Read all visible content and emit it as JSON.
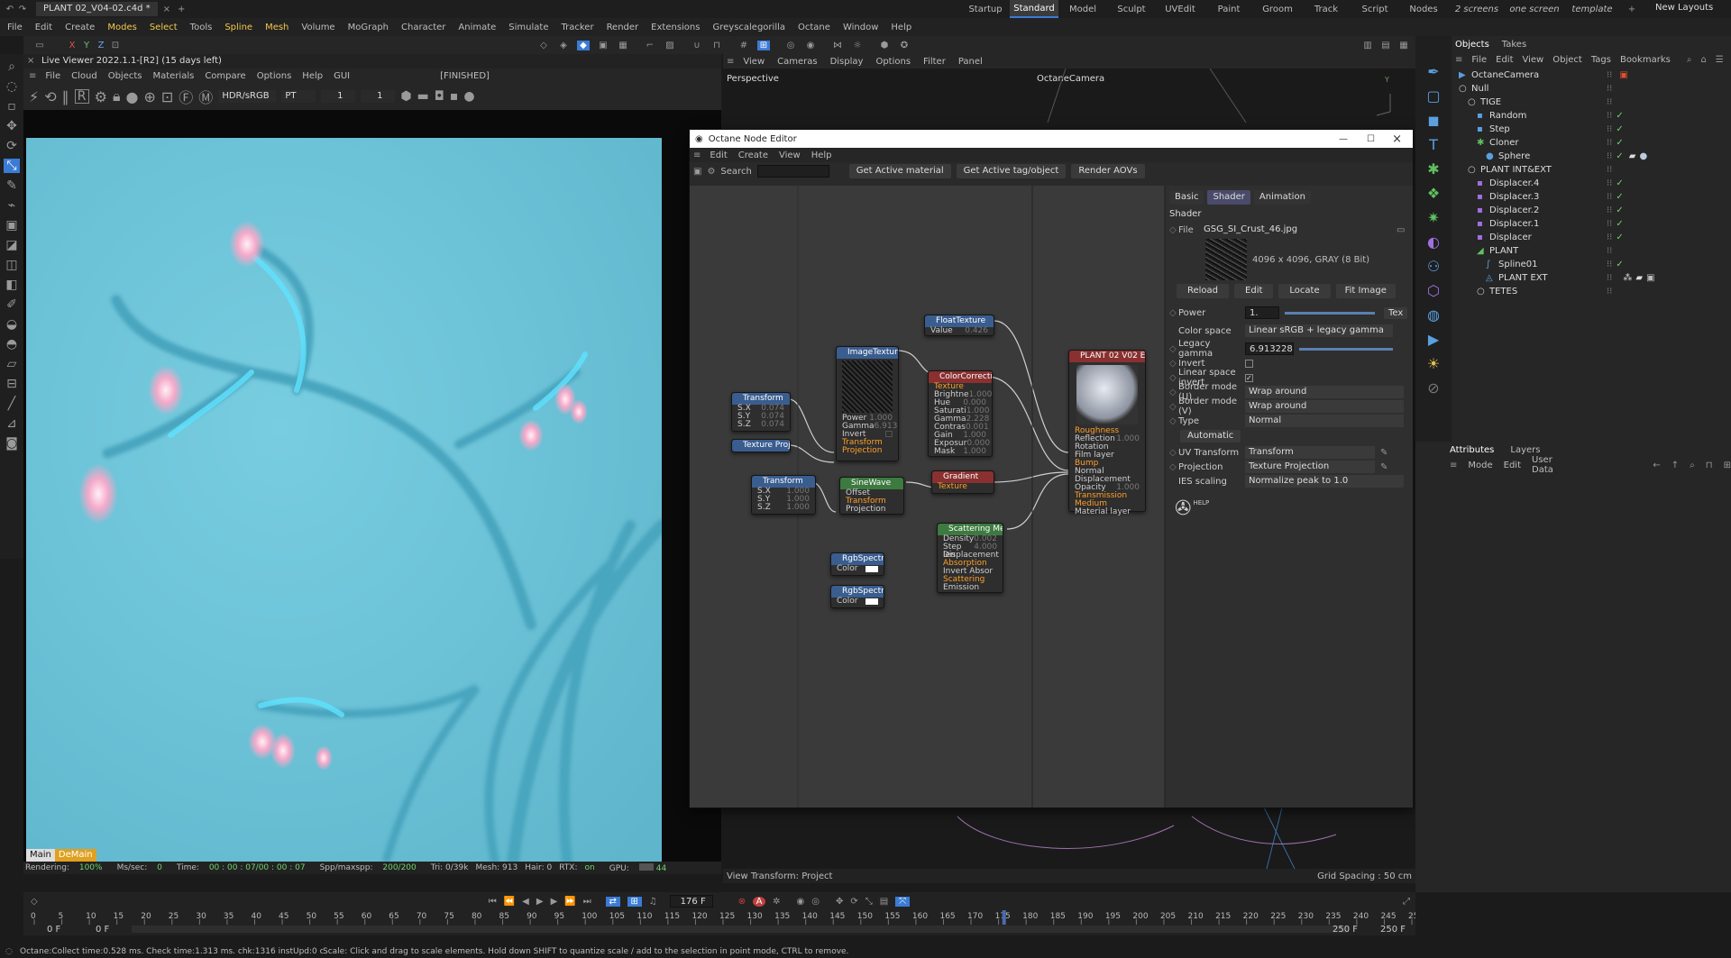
{
  "title_bar": {
    "file_tab": "PLANT 02_V04-02.c4d *",
    "layouts": [
      "Startup",
      "Standard",
      "Model",
      "Sculpt",
      "UVEdit",
      "Paint",
      "Groom",
      "Track",
      "Script",
      "Nodes",
      "2 screens",
      "one screen",
      "template"
    ],
    "active_layout": "Standard",
    "new_layouts": "New Layouts"
  },
  "main_menu": [
    "File",
    "Edit",
    "Create",
    "Modes",
    "Select",
    "Tools",
    "Spline",
    "Mesh",
    "Volume",
    "MoGraph",
    "Character",
    "Animate",
    "Simulate",
    "Tracker",
    "Render",
    "Extensions",
    "Greyscalegorilla",
    "Octane",
    "Window",
    "Help"
  ],
  "live_viewer": {
    "title": "Live Viewer 2022.1.1-[R2] (15 days left)",
    "menu": [
      "File",
      "Cloud",
      "Objects",
      "Materials",
      "Compare",
      "Options",
      "Help",
      "GUI"
    ],
    "status": "[FINISHED]",
    "colorspace": "HDR/sRGB",
    "kernel": "PT",
    "field1": "1",
    "field2": "1",
    "tabs": [
      "Main",
      "DeMain"
    ],
    "footer": {
      "rendering": "Rendering: ",
      "rendering_val": "100%",
      "ms": "Ms/sec: ",
      "ms_val": "0",
      "time": "Time: ",
      "time_val": "00 : 00 : 07/00 : 00 : 07",
      "spp": "Spp/maxspp: ",
      "spp_val": "200/200",
      "tri": "Tri: 0/39k",
      "mesh": "Mesh: 913",
      "hair": "Hair: 0",
      "rtx": "RTX:",
      "rtx_val": "on",
      "gpu": "GPU:",
      "gpu_val": "44"
    }
  },
  "viewport": {
    "menu": [
      "View",
      "Cameras",
      "Display",
      "Options",
      "Filter",
      "Panel"
    ],
    "label": "Perspective",
    "camera": "OctaneCamera",
    "footer_left": "View Transform: Project",
    "footer_right": "Grid Spacing : 50 cm"
  },
  "node_editor": {
    "title": "Octane Node Editor",
    "menu": [
      "Edit",
      "Create",
      "View",
      "Help"
    ],
    "search_label": "Search",
    "buttons": [
      "Get Active material",
      "Get Active tag/object",
      "Render AOVs"
    ],
    "nodes": {
      "float_texture": {
        "title": "FloatTexture",
        "pins": [
          [
            "Value",
            "0.426"
          ]
        ]
      },
      "image_texture": {
        "title": "ImageTexture",
        "pins": [
          [
            "Power",
            "1.000"
          ],
          [
            "Gamma",
            "6.913"
          ],
          [
            "Invert",
            ""
          ]
        ],
        "out": [
          "Transform",
          "Projection"
        ]
      },
      "color_correction": {
        "title": "ColorCorrectio",
        "pins": [
          [
            "Texture",
            ""
          ],
          [
            "Brightne",
            "1.000"
          ],
          [
            "Hue",
            "0.000"
          ],
          [
            "Saturati",
            "1.000"
          ],
          [
            "Gamma",
            "2.228"
          ],
          [
            "Contras",
            "0.001"
          ],
          [
            "Gain",
            "1.000"
          ],
          [
            "Exposur",
            "0.000"
          ],
          [
            "Mask",
            "1.000"
          ]
        ]
      },
      "transform1": {
        "title": "Transform",
        "pins": [
          [
            "S.X",
            "0.074"
          ],
          [
            "S.Y",
            "0.074"
          ],
          [
            "S.Z",
            "0.074"
          ]
        ]
      },
      "texture_proj": {
        "title": "Texture Proj"
      },
      "material": {
        "title": "PLANT 02 V02 EXT",
        "pins": [
          "Roughness",
          "Reflection",
          "Rotation",
          "Film layer",
          "Bump",
          "Normal",
          "Displacement",
          "Opacity",
          "Transmission",
          "Medium",
          "Material layer"
        ],
        "opacity_val": "1.000",
        "reflection_val": "1.000"
      },
      "transform2": {
        "title": "Transform",
        "pins": [
          [
            "S.X",
            "1.000"
          ],
          [
            "S.Y",
            "1.000"
          ],
          [
            "S.Z",
            "1.000"
          ]
        ]
      },
      "sinewave": {
        "title": "SineWave",
        "pins": [
          "Offset",
          "Transform",
          "Projection"
        ]
      },
      "gradient": {
        "title": "Gradient",
        "pins": [
          "Texture"
        ]
      },
      "scattering": {
        "title": "Scattering Me",
        "pins": [
          [
            "Density",
            "0.002"
          ],
          [
            "Step len",
            "4.000"
          ],
          [
            "Displacement",
            ""
          ],
          [
            "Absorption",
            ""
          ],
          [
            "Invert Absor",
            ""
          ],
          [
            "Scattering",
            ""
          ],
          [
            "Emission",
            ""
          ]
        ]
      },
      "rgb1": {
        "title": "RgbSpectrum",
        "pin": "Color"
      },
      "rgb2": {
        "title": "RgbSpectrum",
        "pin": "Color"
      }
    },
    "attr": {
      "tabs": [
        "Basic",
        "Shader",
        "Animation"
      ],
      "active_tab": "Shader",
      "section": "Shader",
      "file_label": "File",
      "file": "GSG_SI_Crust_46.jpg",
      "image_info": "4096 x 4096, GRAY (8 Bit)",
      "img_buttons": [
        "Reload",
        "Edit",
        "Locate",
        "Fit Image"
      ],
      "power_label": "Power",
      "power": "1.",
      "tex_btn": "Tex",
      "color_space_label": "Color space",
      "color_space": "Linear sRGB + legacy gamma",
      "legacy_gamma_label": "Legacy gamma",
      "legacy_gamma": "6.913228",
      "invert_label": "Invert",
      "linear_inv_label": "Linear space invert",
      "border_u_label": "Border mode (U)",
      "border_u": "Wrap around",
      "border_v_label": "Border mode (V)",
      "border_v": "Wrap around",
      "type_label": "Type",
      "type": "Normal",
      "automatic": "Automatic",
      "uv_label": "UV Transform",
      "uv": "Transform",
      "proj_label": "Projection",
      "proj": "Texture Projection",
      "ies_label": "IES scaling",
      "ies": "Normalize peak to 1.0",
      "help": "HELP"
    }
  },
  "objects": {
    "tabs": [
      "Objects",
      "Takes"
    ],
    "menu": [
      "File",
      "Edit",
      "View",
      "Object",
      "Tags",
      "Bookmarks"
    ],
    "items": [
      {
        "name": "OctaneCamera",
        "indent": 0
      },
      {
        "name": "Null",
        "indent": 0
      },
      {
        "name": "TIGE",
        "indent": 1
      },
      {
        "name": "Random",
        "indent": 2
      },
      {
        "name": "Step",
        "indent": 2
      },
      {
        "name": "Cloner",
        "indent": 2
      },
      {
        "name": "Sphere",
        "indent": 3
      },
      {
        "name": "PLANT INT&EXT",
        "indent": 1
      },
      {
        "name": "Displacer.4",
        "indent": 2
      },
      {
        "name": "Displacer.3",
        "indent": 2
      },
      {
        "name": "Displacer.2",
        "indent": 2
      },
      {
        "name": "Displacer.1",
        "indent": 2
      },
      {
        "name": "Displacer",
        "indent": 2
      },
      {
        "name": "PLANT",
        "indent": 2
      },
      {
        "name": "Spline01",
        "indent": 3
      },
      {
        "name": "PLANT EXT",
        "indent": 3
      },
      {
        "name": "TETES",
        "indent": 2
      }
    ]
  },
  "attributes": {
    "tabs": [
      "Attributes",
      "Layers"
    ],
    "menu": [
      "Mode",
      "Edit",
      "User Data"
    ]
  },
  "timeline": {
    "frame": "176 F",
    "ticks": [
      "0",
      "5",
      "10",
      "15",
      "20",
      "25",
      "30",
      "35",
      "40",
      "45",
      "50",
      "55",
      "60",
      "65",
      "70",
      "75",
      "80",
      "85",
      "90",
      "95",
      "100",
      "105",
      "110",
      "115",
      "120",
      "125",
      "130",
      "135",
      "140",
      "145",
      "150",
      "155",
      "160",
      "165",
      "170",
      "175",
      "180",
      "185",
      "190",
      "195",
      "200",
      "205",
      "210",
      "215",
      "220",
      "225",
      "230",
      "235",
      "240",
      "245",
      "250"
    ],
    "current": "176",
    "start1": "0 F",
    "start2": "0 F",
    "end1": "250 F",
    "end2": "250 F"
  },
  "status_bar": {
    "left": "Octane:Collect time:0.528 ms.  Check time:1.313 ms.  chk:1316  instUpd:0  cnt:913",
    "hint": "Scale: Click and drag to scale elements. Hold down SHIFT to quantize scale / add to the selection in point mode, CTRL to remove."
  },
  "colors": {
    "accent": "#3a7bd5",
    "active_layout": "#4a4a6a",
    "render_bg": "#6cc4d8",
    "pin_orange": "#ff9f2a",
    "node_blue": "#3a5d8f",
    "node_red": "#8a3030",
    "node_green": "#3d7a40"
  }
}
